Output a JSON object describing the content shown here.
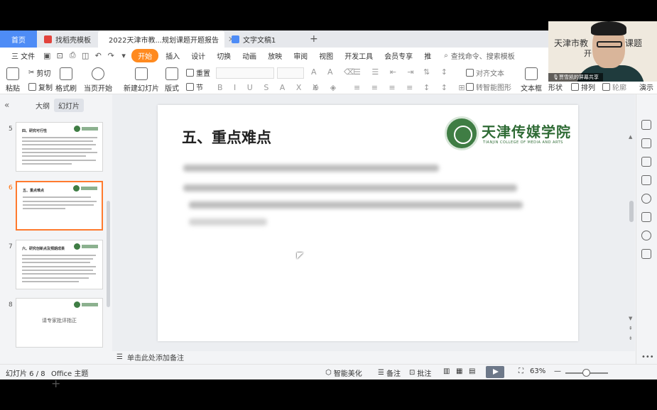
{
  "tabs": [
    {
      "label": "首页",
      "type": "home"
    },
    {
      "label": "找稻壳模板",
      "color": "#e2433c"
    },
    {
      "label": "2022天津市教...规划课题开题报告",
      "color": "#ff7a2e",
      "active": true
    },
    {
      "label": "文字文稿1",
      "color": "#4e8cf6"
    }
  ],
  "menu": {
    "file": "三 文件",
    "items": [
      "开始",
      "插入",
      "设计",
      "切换",
      "动画",
      "放映",
      "审阅",
      "视图",
      "开发工具",
      "会员专享",
      "推"
    ],
    "search": "查找命令、搜索模板"
  },
  "ribbon": {
    "paste": "粘贴",
    "cut": "剪切",
    "copy": "复制",
    "format_painter": "格式刷",
    "from_current": "当页开始",
    "new_slide": "新建幻灯片",
    "layout": "版式",
    "section": "节",
    "reset": "重置",
    "align_text": "对齐文本",
    "convert_smartart": "转智能图形",
    "text_box": "文本框",
    "shape": "形状",
    "arrange": "排列",
    "outline": "轮廓",
    "presenter": "演示"
  },
  "panel": {
    "tab_outline": "大纲",
    "tab_slides": "幻灯片",
    "thumbs": [
      {
        "num": "5",
        "title": "四、研究可行性"
      },
      {
        "num": "6",
        "title": "五、重点难点",
        "current": true
      },
      {
        "num": "7",
        "title": "六、研究创新点及预期成果"
      },
      {
        "num": "8",
        "center_text": "请专家批评指正"
      }
    ]
  },
  "slide": {
    "title": "五、重点难点",
    "logo_cn": "天津传媒学院",
    "logo_en": "TIANJIN COLLEGE OF MEDIA AND ARTS"
  },
  "notes_placeholder": "单击此处添加备注",
  "status": {
    "slide_counter": "幻灯片 6 / 8",
    "theme": "Office 主题",
    "smart_beautify": "智能美化",
    "notes": "备注",
    "comment": "批注",
    "zoom": "63%"
  },
  "webcam": {
    "text1": "天津市教",
    "text2": "开",
    "text_right": "课题",
    "label": "贾雪凯的屏幕共享"
  }
}
